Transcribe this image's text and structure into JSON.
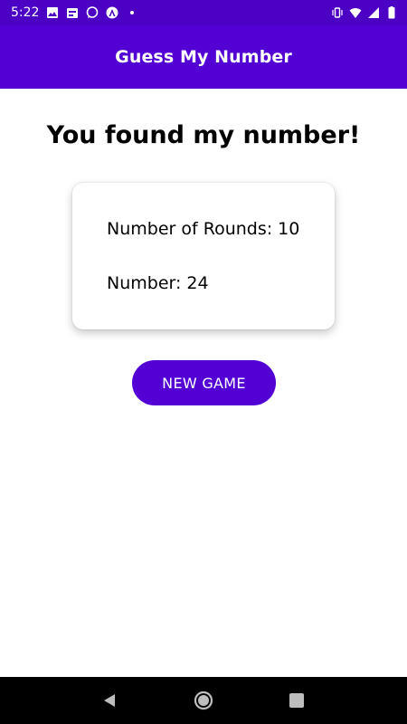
{
  "status_bar": {
    "time": "5:22",
    "left_icons": [
      "image-icon",
      "calendar-icon",
      "chat-icon",
      "app-icon",
      "dot-icon"
    ],
    "right_icons": [
      "vibrate-icon",
      "wifi-icon",
      "signal-icon",
      "battery-icon"
    ]
  },
  "app_bar": {
    "title": "Guess My Number",
    "color": "#5300d4"
  },
  "main": {
    "headline": "You found my number!",
    "summary": {
      "rounds_line": "Number of Rounds: 10",
      "number_line": "Number: 24"
    },
    "new_game_label": "NEW GAME"
  },
  "nav_bar": {
    "buttons": [
      "back-icon",
      "home-icon",
      "recents-icon"
    ]
  },
  "colors": {
    "accent": "#5300d4",
    "status_bar": "#4b00c4"
  }
}
